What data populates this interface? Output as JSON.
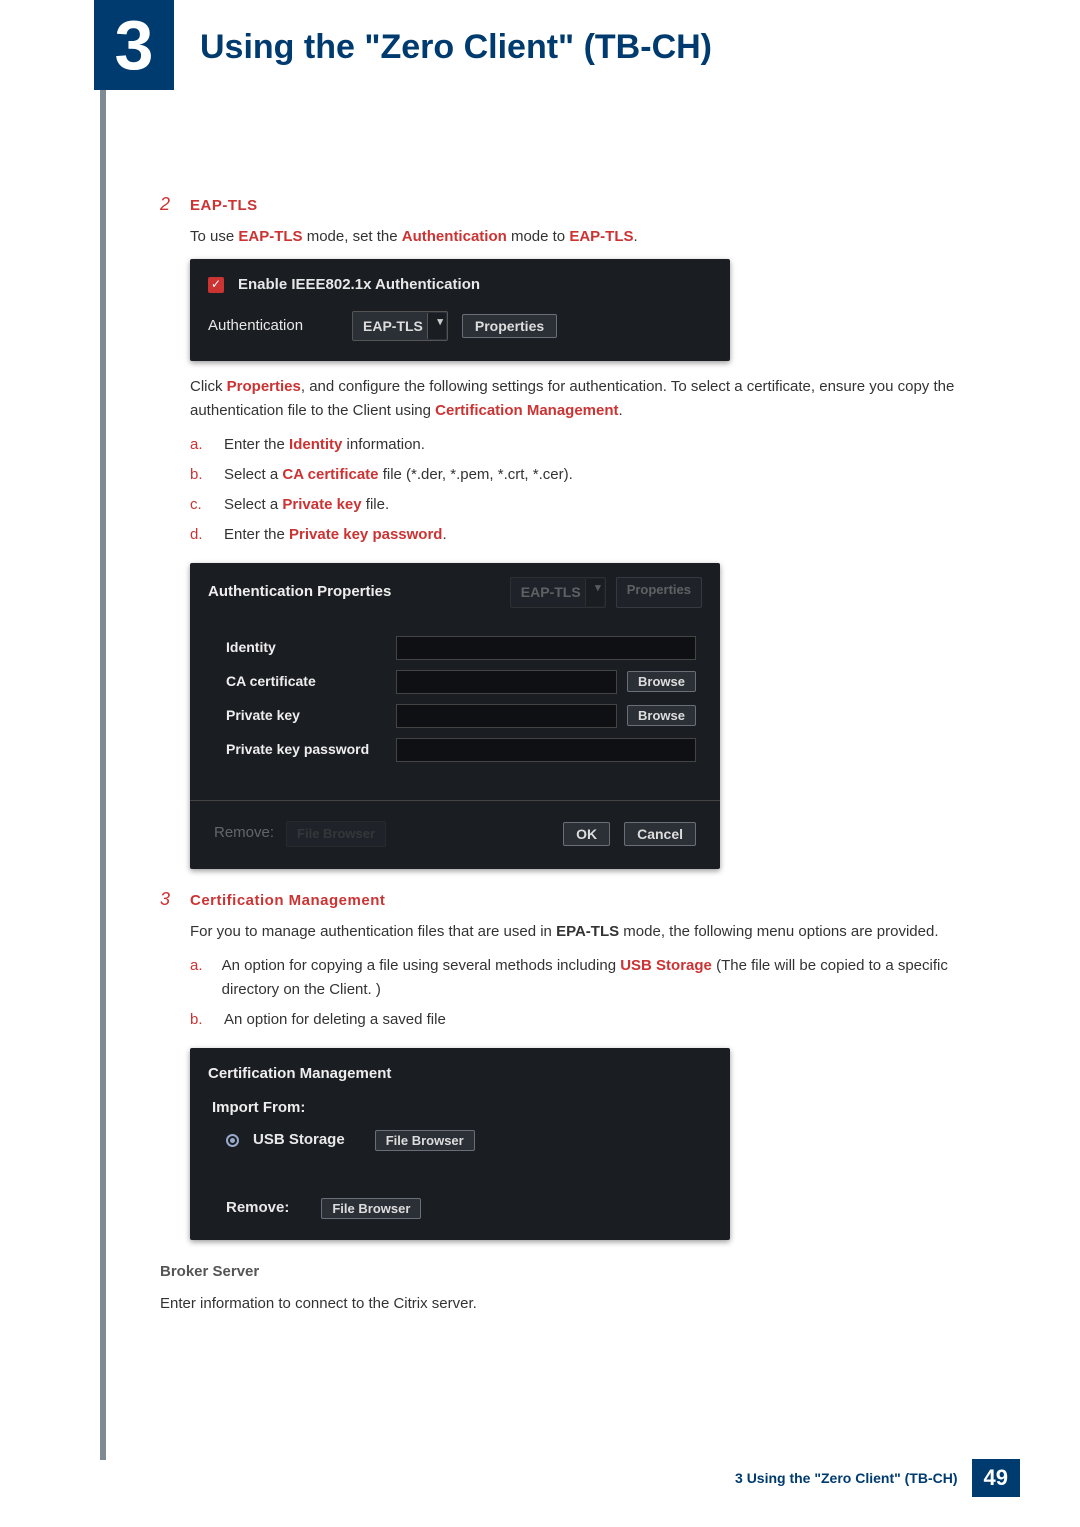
{
  "chapter": {
    "number": "3",
    "title": "Using the \"Zero Client\" (TB-CH)"
  },
  "step2": {
    "num": "2",
    "title": "EAP-TLS",
    "intro_pre": "To use ",
    "intro_b1": "EAP-TLS",
    "intro_mid": " mode, set the ",
    "intro_b2": "Authentication",
    "intro_mid2": " mode to ",
    "intro_b3": "EAP-TLS",
    "intro_end": ".",
    "sc1": {
      "checkbox_label": "Enable IEEE802.1x Authentication",
      "auth_label": "Authentication",
      "auth_value": "EAP-TLS",
      "properties_btn": "Properties"
    },
    "after_sc1_a": "Click ",
    "after_sc1_b": "Properties",
    "after_sc1_c": ", and configure the following settings for authentication. To select a certificate, ensure you copy the authentication file to the Client using ",
    "after_sc1_d": "Certification Management",
    "after_sc1_e": ".",
    "list": {
      "a_m": "a.",
      "a1": "Enter the ",
      "a_b": "Identity",
      "a2": " information.",
      "b_m": "b.",
      "b1": "Select a ",
      "b_b": "CA certificate",
      "b2": " file (*.der, *.pem, *.crt, *.cer).",
      "c_m": "c.",
      "c1": "Select a ",
      "c_b": "Private key",
      "c2": " file.",
      "d_m": "d.",
      "d1": "Enter the ",
      "d_b": "Private key password",
      "d2": "."
    },
    "sc2": {
      "title": "Authentication Properties",
      "ghost_dd": "EAP-TLS",
      "ghost_btn": "Properties",
      "identity": "Identity",
      "ca": "CA certificate",
      "pk": "Private key",
      "pkp": "Private key password",
      "browse": "Browse",
      "remove": "Remove:",
      "file_browser": "File Browser",
      "ok": "OK",
      "cancel": "Cancel"
    }
  },
  "step3": {
    "num": "3",
    "title": "Certification Management",
    "intro_a": "For you to manage authentication files that are used in ",
    "intro_b": "EPA-TLS",
    "intro_c": " mode, the following menu options are provided.",
    "list": {
      "a_m": "a.",
      "a1": "An option for copying a file using several methods including ",
      "a_b": "USB Storage",
      "a2": " (The file will be copied to a specific directory on the Client. )",
      "b_m": "b.",
      "b1": "An option for deleting a saved file"
    },
    "sc3": {
      "title": "Certification Management",
      "import_from": "Import From:",
      "usb": "USB Storage",
      "file_browser": "File Browser",
      "remove": "Remove:"
    }
  },
  "broker": {
    "heading": "Broker Server",
    "text": "Enter information to connect to the Citrix server."
  },
  "footer": {
    "text": "3 Using the \"Zero Client\" (TB-CH)",
    "page": "49"
  }
}
